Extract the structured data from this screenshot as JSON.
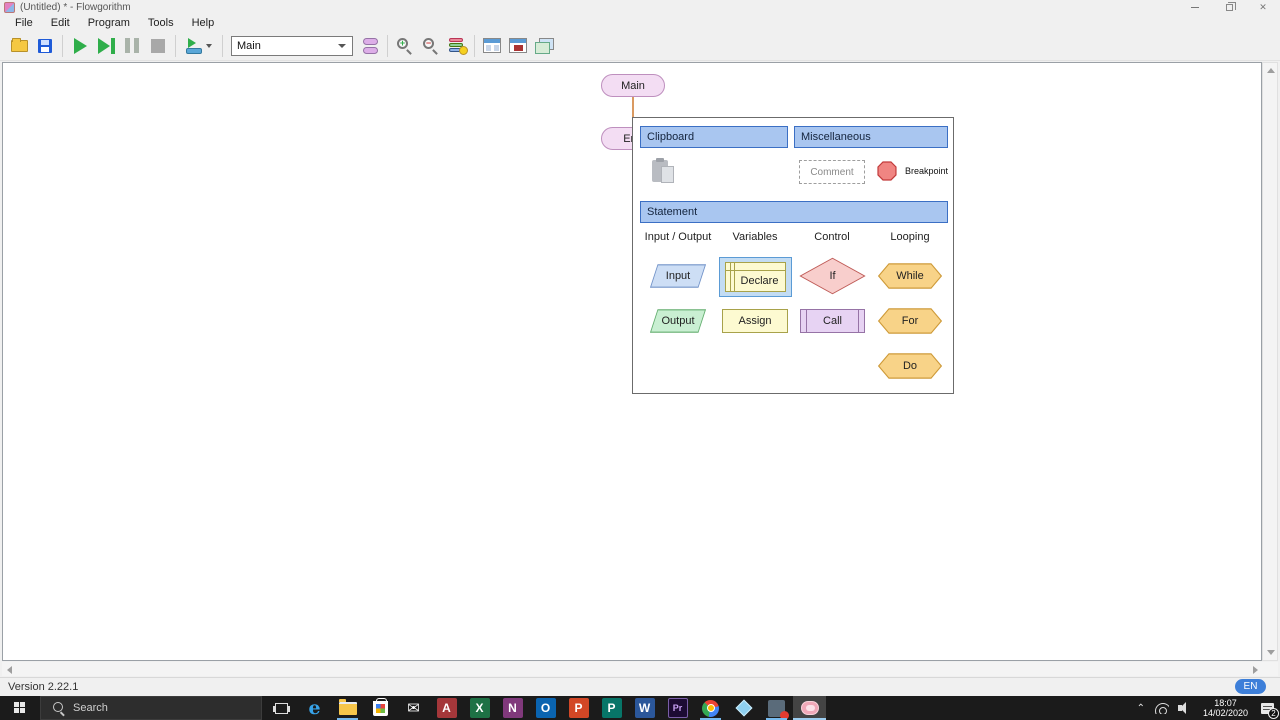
{
  "window": {
    "title": "(Untitled) * - Flowgorithm",
    "close_glyph": "✕"
  },
  "menu": {
    "items": [
      "File",
      "Edit",
      "Program",
      "Tools",
      "Help"
    ]
  },
  "toolbar": {
    "function_selector_value": "Main"
  },
  "canvas": {
    "main_node_label": "Main",
    "end_node_label": "End"
  },
  "palette": {
    "clipboard_header": "Clipboard",
    "misc_header": "Miscellaneous",
    "statement_header": "Statement",
    "comment_label": "Comment",
    "breakpoint_label": "Breakpoint",
    "columns": [
      "Input / Output",
      "Variables",
      "Control",
      "Looping"
    ],
    "shapes": {
      "input": "Input",
      "output": "Output",
      "declare": "Declare",
      "assign": "Assign",
      "if": "If",
      "call": "Call",
      "while": "While",
      "for": "For",
      "do": "Do"
    }
  },
  "statusbar": {
    "version": "Version 2.22.1",
    "language_badge": "EN"
  },
  "taskbar": {
    "search_placeholder": "Search",
    "apps": [
      {
        "name": "edge",
        "glyph": "e"
      },
      {
        "name": "file-explorer",
        "glyph": ""
      },
      {
        "name": "store",
        "glyph": ""
      },
      {
        "name": "mail",
        "glyph": "✉"
      },
      {
        "name": "access",
        "glyph": "A"
      },
      {
        "name": "excel",
        "glyph": "X"
      },
      {
        "name": "onenote",
        "glyph": "N"
      },
      {
        "name": "outlook",
        "glyph": "O"
      },
      {
        "name": "powerpoint",
        "glyph": "P"
      },
      {
        "name": "publisher",
        "glyph": "P"
      },
      {
        "name": "word",
        "glyph": "W"
      },
      {
        "name": "premiere",
        "glyph": "Pr"
      },
      {
        "name": "chrome",
        "glyph": ""
      },
      {
        "name": "onedrive-diamond",
        "glyph": ""
      },
      {
        "name": "photos",
        "glyph": ""
      },
      {
        "name": "flowgorithm",
        "glyph": ""
      }
    ],
    "tray": {
      "hidden_icons_chevron": "⌃",
      "time": "18:07",
      "date": "14/02/2020",
      "notification_count": "2"
    }
  },
  "colors": {
    "section_header_fill": "#A9C6F0",
    "terminal_fill": "#F3DDF3",
    "input_fill": "#CDDEF5",
    "output_fill": "#C9EFD2",
    "declare_assign_fill": "#FDFAD1",
    "if_fill": "#F8CECC",
    "call_fill": "#E7D3F3",
    "loop_fill": "#F8D388",
    "breakpoint_fill": "#F08582",
    "selection_highlight": "#C3DCF3",
    "language_badge_blue": "#3d7fd9",
    "connector_orange": "#DA9A61"
  }
}
